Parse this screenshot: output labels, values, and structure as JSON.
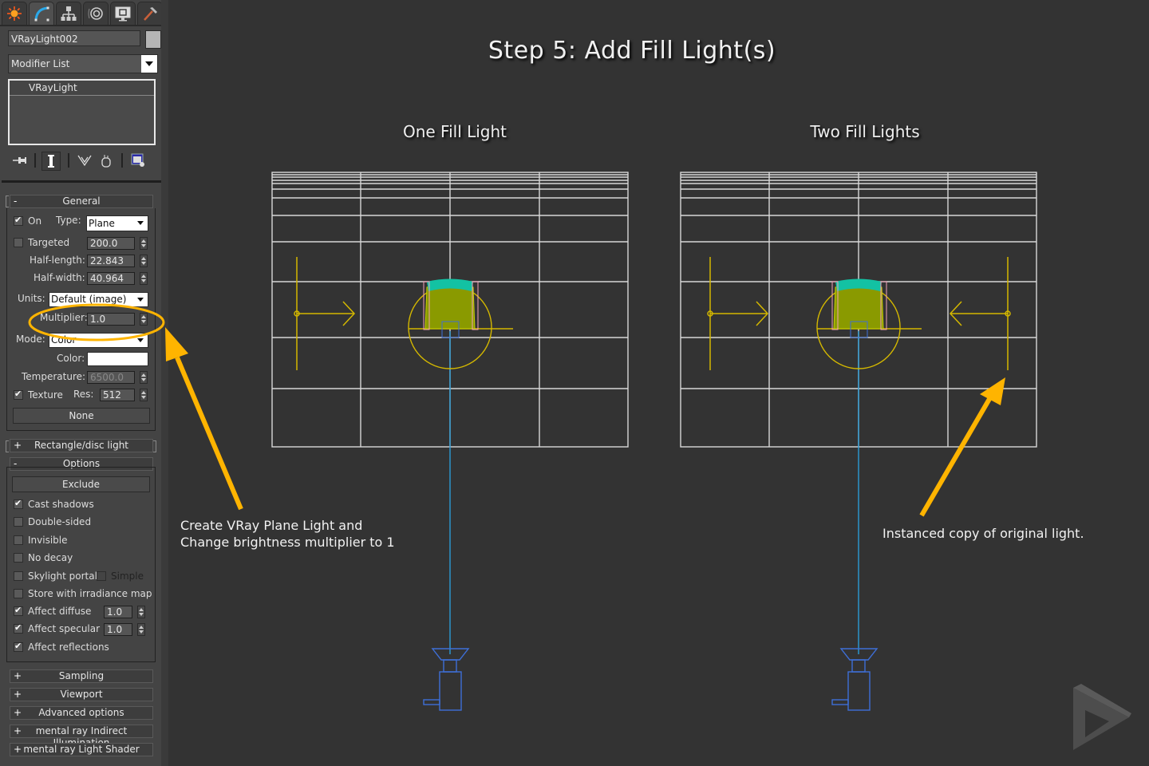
{
  "command_panel": {
    "tabs": [
      {
        "name": "create",
        "icon": "sun-icon"
      },
      {
        "name": "modify",
        "icon": "modify-curve-icon",
        "active": true
      },
      {
        "name": "hierarchy",
        "icon": "hierarchy-icon"
      },
      {
        "name": "motion",
        "icon": "motion-icon"
      },
      {
        "name": "display",
        "icon": "display-monitor-icon"
      },
      {
        "name": "utilities",
        "icon": "hammer-icon"
      }
    ],
    "object_name": "VRayLight002",
    "object_color": "#b5b5b5",
    "modifier_list": "Modifier List",
    "stack": [
      "VRayLight"
    ],
    "stack_tools": [
      "pin-stack-icon",
      "show-end-result-icon",
      "make-unique-icon",
      "remove-modifier-icon",
      "configure-modifier-sets-icon"
    ]
  },
  "general": {
    "title": "General",
    "sign": "-",
    "on_label": "On",
    "on_checked": true,
    "type_label": "Type:",
    "type_value": "Plane",
    "targeted_label": "Targeted",
    "targeted_checked": false,
    "targeted_value": "200.0",
    "half_length_label": "Half-length:",
    "half_length_value": "22.843",
    "half_width_label": "Half-width:",
    "half_width_value": "40.964",
    "units_label": "Units:",
    "units_value": "Default (image)",
    "multiplier_label": "Multiplier:",
    "multiplier_value": "1.0",
    "mode_label": "Mode:",
    "mode_value": "Color",
    "color_label": "Color:",
    "color_value": "#ffffff",
    "temperature_label": "Temperature:",
    "temperature_value": "6500.0",
    "texture_label": "Texture",
    "texture_checked": true,
    "res_label": "Res:",
    "res_value": "512",
    "none_button": "None"
  },
  "rect_disc": {
    "title": "Rectangle/disc light",
    "sign": "+"
  },
  "options": {
    "title": "Options",
    "sign": "-",
    "exclude_button": "Exclude",
    "items": [
      {
        "label": "Cast shadows",
        "checked": true
      },
      {
        "label": "Double-sided",
        "checked": false
      },
      {
        "label": "Invisible",
        "checked": false
      },
      {
        "label": "No decay",
        "checked": false
      },
      {
        "label": "Skylight portal",
        "checked": false
      },
      {
        "label": "Store with irradiance map",
        "checked": false
      },
      {
        "label": "Affect diffuse",
        "checked": true
      },
      {
        "label": "Affect specular",
        "checked": true
      },
      {
        "label": "Affect reflections",
        "checked": true
      }
    ],
    "simple_label": "Simple",
    "simple_checked": false,
    "affect_diffuse_value": "1.0",
    "affect_specular_value": "1.0"
  },
  "collapsed_rollouts": [
    {
      "title": "Sampling",
      "sign": "+"
    },
    {
      "title": "Viewport",
      "sign": "+"
    },
    {
      "title": "Advanced options",
      "sign": "+"
    },
    {
      "title": "mental ray Indirect Illumination",
      "sign": "+"
    },
    {
      "title": "mental ray Light Shader",
      "sign": "+"
    }
  ],
  "main": {
    "title": "Step 5: Add Fill Light(s)",
    "left_view_title": "One Fill Light",
    "right_view_title": "Two Fill Lights",
    "left_caption_line1": "Create VRay Plane Light and",
    "left_caption_line2": "Change brightness multiplier to 1",
    "right_caption": "Instanced copy of original light.",
    "annotation_color": "#ffb400",
    "light_color": "#d4b800",
    "camera_color": "#3e6fd8",
    "target_line_color": "#2b9bd6"
  }
}
